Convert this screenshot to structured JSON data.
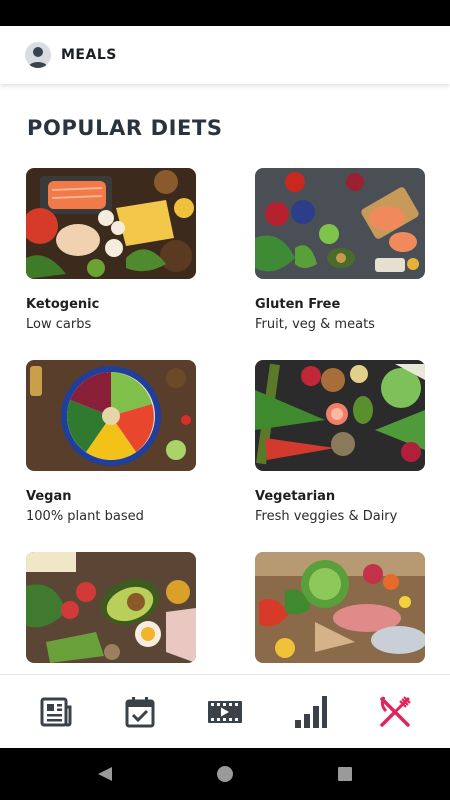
{
  "header": {
    "title": "MEALS",
    "avatar_icon": "user-avatar-icon"
  },
  "section": {
    "title": "POPULAR DIETS"
  },
  "diets": [
    {
      "name": "Ketogenic",
      "description": "Low carbs"
    },
    {
      "name": "Gluten Free",
      "description": "Fruit, veg & meats"
    },
    {
      "name": "Vegan",
      "description": "100% plant based"
    },
    {
      "name": "Vegetarian",
      "description": "Fresh veggies & Dairy"
    },
    {
      "name": "",
      "description": ""
    },
    {
      "name": "",
      "description": ""
    }
  ],
  "bottom_nav": {
    "items": [
      {
        "icon": "news-icon",
        "active": false
      },
      {
        "icon": "calendar-check-icon",
        "active": false
      },
      {
        "icon": "video-icon",
        "active": false
      },
      {
        "icon": "stats-icon",
        "active": false
      },
      {
        "icon": "fork-knife-icon",
        "active": true
      }
    ]
  },
  "colors": {
    "active": "#e0245e",
    "inactive": "#3b4148",
    "title": "#2a3440"
  }
}
